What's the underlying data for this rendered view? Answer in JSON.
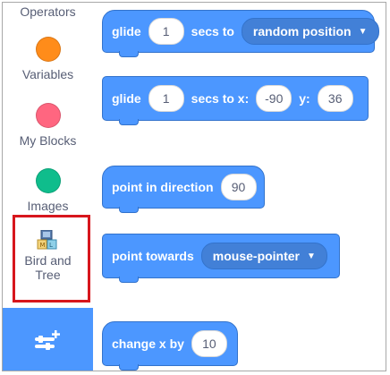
{
  "categories": [
    {
      "label": "Operators",
      "color": "#59c059"
    },
    {
      "label": "Variables",
      "color": "#ff8c1a"
    },
    {
      "label": "My Blocks",
      "color": "#ff6680"
    },
    {
      "label": "Images",
      "color": "#0fbd8c"
    },
    {
      "label_line1": "Bird and",
      "label_line2": "Tree",
      "icon": "bird-and-tree-extension-icon"
    }
  ],
  "add_extension": {
    "icon": "add-extension-icon"
  },
  "blocks": {
    "glide_random": {
      "glide": "glide",
      "secs": "1",
      "secs_to": "secs to",
      "target": "random position"
    },
    "glide_xy": {
      "glide": "glide",
      "secs": "1",
      "secs_to_x": "secs to x:",
      "x": "-90",
      "y_label": "y:",
      "y": "36"
    },
    "point_direction": {
      "label": "point in direction",
      "value": "90"
    },
    "point_towards": {
      "label": "point towards",
      "target": "mouse-pointer"
    },
    "change_x": {
      "label": "change x by",
      "value": "10"
    }
  },
  "colors": {
    "motion": "#4c97ff",
    "highlight": "#d7161d"
  }
}
